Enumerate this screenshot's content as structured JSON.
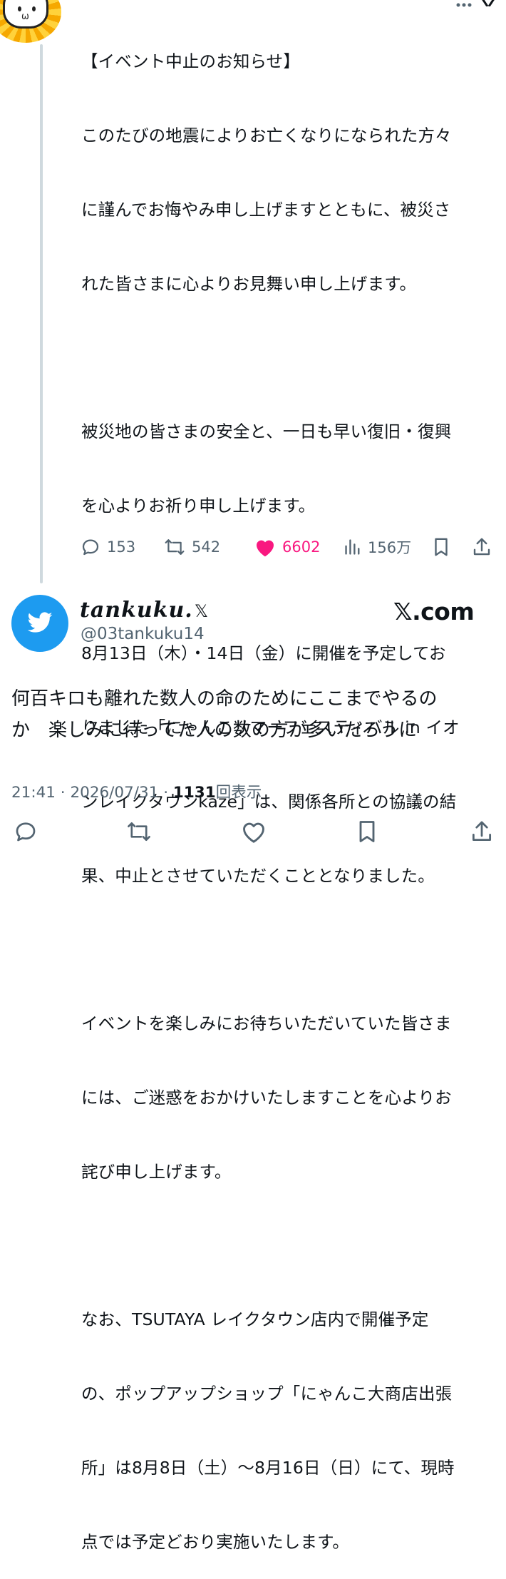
{
  "announcement": {
    "lines": [
      "【イベント中止のお知らせ】",
      "このたびの地震によりお亡くなりになられた方々",
      "に謹んでお悔やみ申し上げますとともに、被災さ",
      "れた皆さまに心よりお見舞い申し上げます。",
      "",
      "被災地の皆さまの安全と、一日も早い復旧・復興",
      "を心よりお祈り申し上げます。",
      "",
      "8月13日（木）・14日（金）に開催を予定してお",
      "りました「にゃんこサマーフェスティバル in イオ",
      "ンレイクタウンkaze」は、関係各所との協議の結",
      "果、中止とさせていただくこととなりました。",
      "",
      "イベントを楽しみにお待ちいただいていた皆さま",
      "には、ご迷惑をおかけいたしますことを心よりお",
      "詫び申し上げます。",
      "",
      "なお、TSUTAYA レイクタウン店内で開催予定",
      "の、ポップアップショップ「にゃんこ大商店出張",
      "所」は8月8日（土）〜8月16日（日）にて、現時",
      "点では予定どおり実施いたします。"
    ]
  },
  "quoted_actions": {
    "replies": "153",
    "reposts": "542",
    "likes": "6602",
    "views": "156万"
  },
  "quote_user": {
    "name": "tankuku.",
    "x_glyph": "𝕏",
    "handle": "@03tankuku14",
    "brand": "𝕏.com"
  },
  "tweet": {
    "text": "何百キロも離れた数人の命のためにここまでやるの\nか　楽しみに待ってた人の数の方が多いだろうに",
    "time": "21:41 · 2026/07/31 · ",
    "views_count": "1131",
    "views_label": "回表示"
  },
  "colors": {
    "like_pink": "#f91880",
    "twitter_blue": "#1d9bf0",
    "muted": "#536471"
  }
}
